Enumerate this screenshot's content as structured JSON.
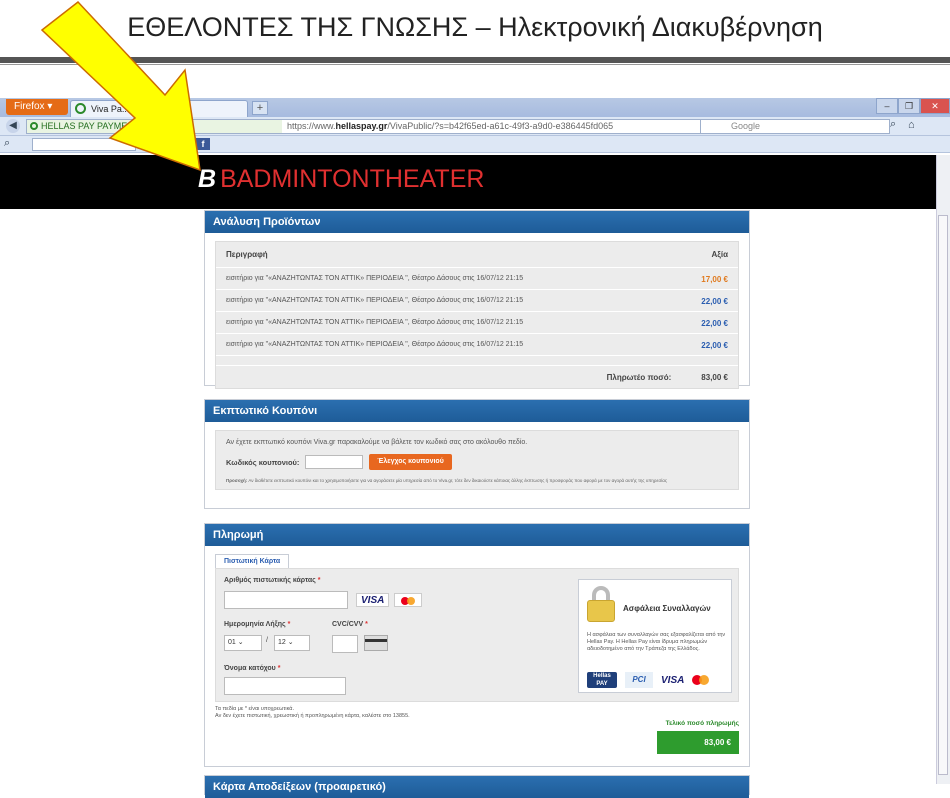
{
  "slide": {
    "title": "ΕΘΕΛΟΝΤΕΣ ΤΗΣ ΓΝΩΣΗΣ – Ηλεκτρονική Διακυβέρνηση"
  },
  "browser": {
    "firefox_label": "Firefox ▾",
    "tab_title": "Viva Pa...",
    "new_tab": "+",
    "site_identity": "HELLAS PAY PAYMENT S... (GR)",
    "url_prefix": "https://www.",
    "url_domain": "hellaspay.gr",
    "url_path": "/VivaPublic/?s=b42f65ed-a61c-49f3-a9d0-e386445fd065",
    "search_engine": "Google",
    "toolbar_search_label": "Search",
    "toolbar_fb": "f"
  },
  "header": {
    "logo_mark": "B",
    "logo_text": "BADMINTONTHEATER"
  },
  "products": {
    "heading": "Ανάλυση Προϊόντων",
    "col_description": "Περιγραφή",
    "col_value": "Αξία",
    "rows": [
      {
        "description": "εισιτήριο για \"«ΑΝΑΖΗΤΩΝΤΑΣ ΤΟΝ ΑΤΤΙΚ» ΠΕΡΙΟΔΕΙΑ \", Θέατρο Δάσους στις 16/07/12 21:15",
        "amount": "17,00 €"
      },
      {
        "description": "εισιτήριο για \"«ΑΝΑΖΗΤΩΝΤΑΣ ΤΟΝ ΑΤΤΙΚ» ΠΕΡΙΟΔΕΙΑ \", Θέατρο Δάσους στις 16/07/12 21:15",
        "amount": "22,00 €"
      },
      {
        "description": "εισιτήριο για \"«ΑΝΑΖΗΤΩΝΤΑΣ ΤΟΝ ΑΤΤΙΚ» ΠΕΡΙΟΔΕΙΑ \", Θέατρο Δάσους στις 16/07/12 21:15",
        "amount": "22,00 €"
      },
      {
        "description": "εισιτήριο για \"«ΑΝΑΖΗΤΩΝΤΑΣ ΤΟΝ ΑΤΤΙΚ» ΠΕΡΙΟΔΕΙΑ \", Θέατρο Δάσους στις 16/07/12 21:15",
        "amount": "22,00 €"
      }
    ],
    "total_label": "Πληρωτέο ποσό:",
    "total_value": "83,00 €"
  },
  "coupon": {
    "heading": "Εκπτωτικό Κουπόνι",
    "intro": "Αν έχετε εκπτωτικό κουπόνι Viva.gr παρακαλούμε να βάλετε τον κωδικό σας στο ακόλουθο πεδίο.",
    "code_label": "Κωδικός κουπονιού:",
    "check_button": "Έλεγχος κουπονιού",
    "note_bold": "Προσοχή:",
    "note": "Αν διαθέτετε εκπτωτικό κουπόνι και το χρησιμοποιήσετε για να αγοράσετε μία υπηρεσία από το Viva.gr, τότε δεν δικαιούστε κάποιας άλλης έκπτωσης ή προσφοράς που αφορά με τον αγορά αυτής της υπηρεσίας"
  },
  "payment": {
    "heading": "Πληρωμή",
    "tab_card": "Πιστωτική Κάρτα",
    "card_number_label": "Αριθμός πιστωτικής κάρτας",
    "expiry_label": "Ημερομηνία Λήξης",
    "expiry_month": "01",
    "expiry_year": "12",
    "cvv_label": "CVC/CVV",
    "holder_label": "Όνομα κατόχου",
    "required_mark": "*",
    "visa": "VISA",
    "security_title": "Ασφάλεια Συναλλαγών",
    "security_text": "Η ασφάλεια των συναλλαγών σας εξασφαλίζεται από την Hellas Pay. Η Hellas Pay είναι ίδρυμα πληρωμών αδειοδοτημένο από την Τράπεζα της Ελλάδος.",
    "hellaspay_logo": "Hellas PAY",
    "pci_logo": "PCI",
    "notes_required": "Τα πεδία με * είναι υποχρεωτικά.",
    "notes_help": "Αν δεν έχετε πιστωτική, χρεωστική ή προπληρωμένη κάρτα, καλέστε στο 13855.",
    "total_label": "Τελικό ποσό πληρωμής",
    "total_value": "83,00 €"
  },
  "receipts": {
    "heading": "Κάρτα Αποδείξεων (προαιρετικό)"
  }
}
